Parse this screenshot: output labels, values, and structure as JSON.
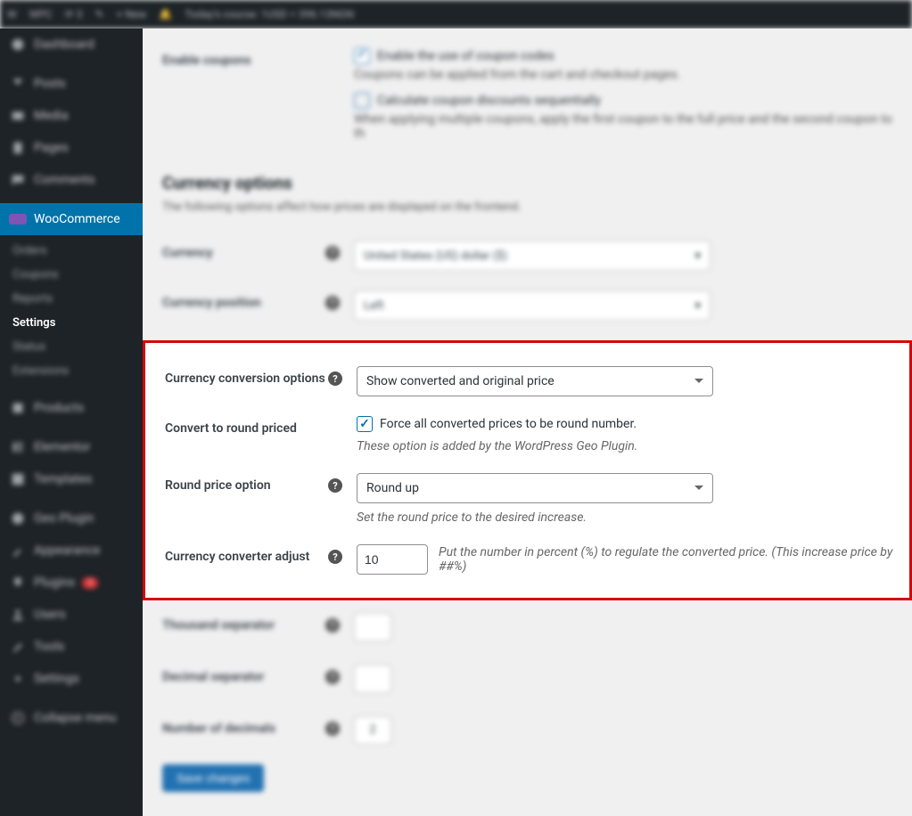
{
  "adminbar": {
    "items": [
      "⚙",
      "WPC",
      "⟳ 3",
      "✎",
      "+ New",
      "🔔"
    ],
    "info": "Today's course: 1USD = 396.13NGN"
  },
  "sidebar": {
    "dashboard": "Dashboard",
    "posts": "Posts",
    "media": "Media",
    "pages": "Pages",
    "comments": "Comments",
    "woocommerce": "WooCommerce",
    "submenu": {
      "orders": "Orders",
      "coupons": "Coupons",
      "reports": "Reports",
      "settings": "Settings",
      "status": "Status",
      "extensions": "Extensions"
    },
    "products": "Products",
    "elementor": "Elementor",
    "templates": "Templates",
    "geo_plugin": "Geo Plugin",
    "appearance": "Appearance",
    "plugins": "Plugins",
    "users": "Users",
    "tools": "Tools",
    "settings_wp": "Settings",
    "collapse": "Collapse menu"
  },
  "page": {
    "enable_coupons_label": "Enable coupons",
    "enable_coupons_check": "Enable the use of coupon codes",
    "enable_coupons_desc": "Coupons can be applied from the cart and checkout pages.",
    "calc_sequential": "Calculate coupon discounts sequentially",
    "calc_sequential_desc": "When applying multiple coupons, apply the first coupon to the full price and the second coupon to th",
    "currency_options_heading": "Currency options",
    "currency_options_sub": "The following options affect how prices are displayed on the frontend.",
    "currency_label": "Currency",
    "currency_value": "United States (US) dollar ($)",
    "currency_position_label": "Currency position",
    "currency_position_value": "Left",
    "conversion_label": "Currency conversion options",
    "conversion_value": "Show converted and original price",
    "round_label": "Convert to round priced",
    "round_check_label": "Force all converted prices to be round number.",
    "round_desc": "These option is added by the WordPress Geo Plugin.",
    "round_option_label": "Round price option",
    "round_option_value": "Round up",
    "round_option_desc": "Set the round price to the desired increase.",
    "adjust_label": "Currency converter adjust",
    "adjust_value": "10",
    "adjust_desc": "Put the number in percent (%) to regulate the converted price. (This increase price by ##%)",
    "thousand_label": "Thousand separator",
    "decimal_label": "Decimal separator",
    "num_decimals_label": "Number of decimals",
    "num_decimals_value": "2",
    "save_btn": "Save changes"
  }
}
